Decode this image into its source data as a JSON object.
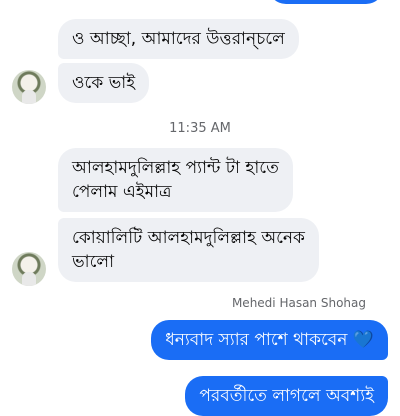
{
  "chat": {
    "timestamp": "11:35 AM",
    "messages": [
      {
        "direction": "incoming",
        "text": "ও আচ্ছা, আমাদের উত্তরান্চলে"
      },
      {
        "direction": "incoming",
        "text": "ওকে ভাই"
      },
      {
        "direction": "incoming",
        "lines": [
          "আলহামদুলিল্লাহ প্যান্ট টা হাতে",
          "পেলাম এইমাত্র"
        ]
      },
      {
        "direction": "incoming",
        "lines": [
          "কোয়ালিটি আলহামদুলিল্লাহ অনেক",
          "ভালো"
        ]
      },
      {
        "direction": "outgoing",
        "text": "ধন্যবাদ স্যার পাশে থাকবেন",
        "emoji": "💙"
      },
      {
        "direction": "outgoing",
        "text": "পরবর্তীতে লাগলে অবশ্যই"
      }
    ],
    "sender_name": "Mehedi Hasan Shohag",
    "colors": {
      "outgoing_bubble": "#1a6df5",
      "incoming_bubble": "#eef0f4",
      "meta_text": "#65676b"
    }
  }
}
